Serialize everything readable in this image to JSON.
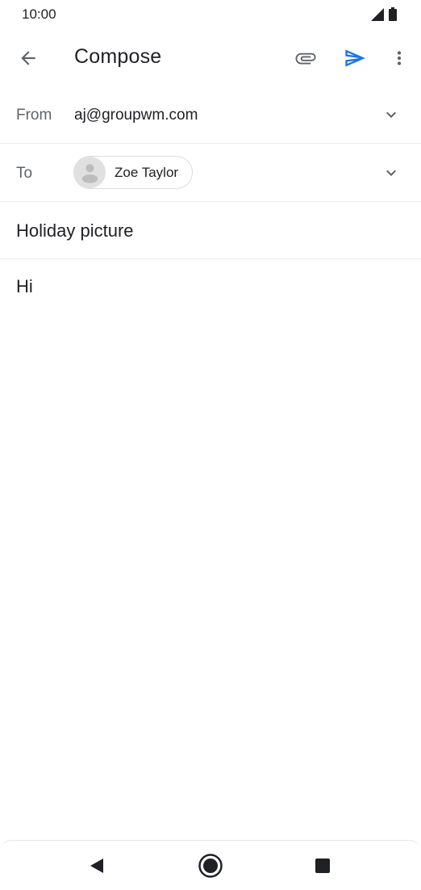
{
  "status_bar": {
    "time": "10:00",
    "icons": [
      "cell-signal-icon",
      "battery-icon"
    ]
  },
  "app_bar": {
    "title": "Compose",
    "icons": {
      "back": "arrow-back-icon",
      "attach": "paperclip-icon",
      "send": "send-icon",
      "more": "more-vert-icon"
    },
    "accent_color": "#1a73e8"
  },
  "compose": {
    "from_label": "From",
    "from_value": "aj@groupwm.com",
    "to_label": "To",
    "recipient": "Zoe Taylor",
    "subject": "Holiday picture",
    "body": "Hi"
  },
  "nav_bar": {
    "icons": [
      "nav-back-icon",
      "nav-home-icon",
      "nav-recents-icon"
    ]
  }
}
